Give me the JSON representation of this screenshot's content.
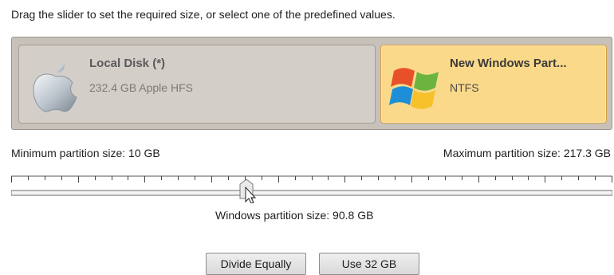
{
  "instruction": "Drag the slider to set the required size, or select one of the predefined values.",
  "partitions": [
    {
      "title": "Local Disk (*)",
      "subtitle": "232.4 GB Apple HFS",
      "icon": "apple-icon"
    },
    {
      "title": "New Windows Part...",
      "subtitle": "NTFS",
      "icon": "windows-logo-icon"
    }
  ],
  "limits": {
    "min": "Minimum partition size: 10 GB",
    "max": "Maximum partition size: 217.3 GB"
  },
  "slider": {
    "caption": "Windows partition size: 90.8 GB",
    "value_gb": 90.8,
    "min_gb": 10,
    "max_gb": 217.3
  },
  "buttons": {
    "divide_equally": "Divide Equally",
    "use_32gb": "Use 32 GB"
  },
  "colors": {
    "selected_card": "#fbd98a",
    "panel_bg": "#c7c1ba"
  }
}
